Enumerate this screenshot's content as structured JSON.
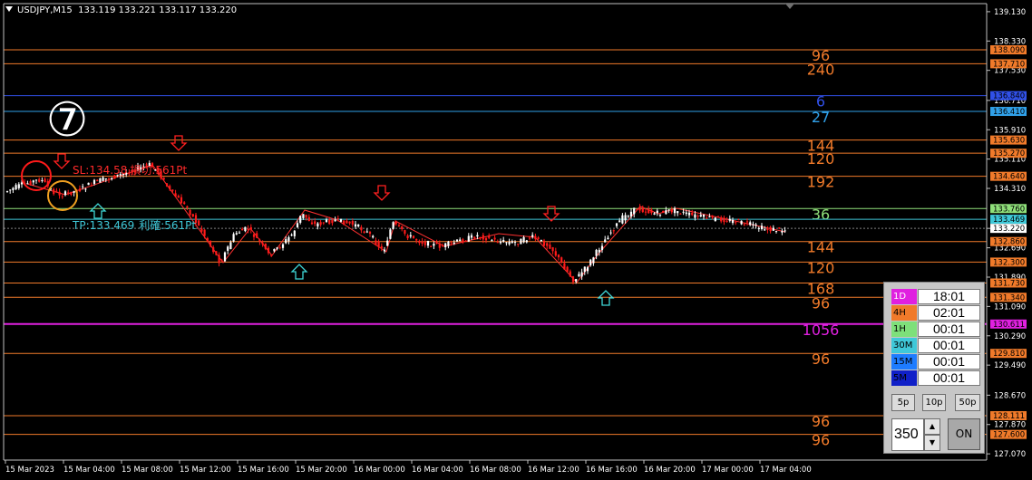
{
  "header": {
    "symbol": "USDJPY,M15",
    "ohlc": "133.119 133.221 133.117 133.220"
  },
  "price_axis": {
    "range": [
      126.9,
      139.35
    ],
    "ticks": [
      "139.130",
      "138.330",
      "137.530",
      "136.710",
      "135.910",
      "135.110",
      "134.310",
      "133.220",
      "132.690",
      "131.890",
      "131.090",
      "130.290",
      "129.490",
      "128.670",
      "127.870",
      "127.070"
    ]
  },
  "time_axis": {
    "labels": [
      "15 Mar 2023",
      "15 Mar 04:00",
      "15 Mar 08:00",
      "15 Mar 12:00",
      "15 Mar 16:00",
      "15 Mar 20:00",
      "16 Mar 00:00",
      "16 Mar 04:00",
      "16 Mar 08:00",
      "16 Mar 12:00",
      "16 Mar 16:00",
      "16 Mar 20:00",
      "17 Mar 00:00",
      "17 Mar 04:00"
    ]
  },
  "levels": [
    {
      "price": "138.090",
      "label": "96",
      "color": "#f07a2a",
      "tag_bg": "#f07a2a"
    },
    {
      "price": "137.710",
      "label": "240",
      "color": "#f07a2a",
      "tag_bg": "#f07a2a"
    },
    {
      "price": "136.840",
      "label": "6",
      "color": "#3050e8",
      "tag_bg": "#3050e8"
    },
    {
      "price": "136.410",
      "label": "27",
      "color": "#30a0e8",
      "tag_bg": "#30a0e8"
    },
    {
      "price": "135.630",
      "label": "144",
      "color": "#f07a2a",
      "tag_bg": "#f07a2a"
    },
    {
      "price": "135.270",
      "label": "120",
      "color": "#f07a2a",
      "tag_bg": "#f07a2a"
    },
    {
      "price": "134.640",
      "label": "192",
      "color": "#f07a2a",
      "tag_bg": "#f07a2a"
    },
    {
      "price": "133.760",
      "label": "36",
      "color": "#8fe07a",
      "tag_bg": "#8fe07a"
    },
    {
      "price": "133.469",
      "label": "",
      "color": "#3fc8d8",
      "tag_bg": "#3fc8d8"
    },
    {
      "price": "132.860",
      "label": "144",
      "color": "#f07a2a",
      "tag_bg": "#f07a2a"
    },
    {
      "price": "132.300",
      "label": "120",
      "color": "#f07a2a",
      "tag_bg": "#f07a2a"
    },
    {
      "price": "131.730",
      "label": "168",
      "color": "#f07a2a",
      "tag_bg": "#f07a2a"
    },
    {
      "price": "131.340",
      "label": "96",
      "color": "#f07a2a",
      "tag_bg": "#f07a2a"
    },
    {
      "price": "130.611",
      "label": "1056",
      "color": "#e020e0",
      "tag_bg": "#e020e0"
    },
    {
      "price": "129.810",
      "label": "96",
      "color": "#f07a2a",
      "tag_bg": "#f07a2a"
    },
    {
      "price": "128.111",
      "label": "96",
      "color": "#f07a2a",
      "tag_bg": "#f07a2a"
    },
    {
      "price": "127.600",
      "label": "96",
      "color": "#f07a2a",
      "tag_bg": "#f07a2a"
    }
  ],
  "current_price": {
    "price": "133.220",
    "tag_bg": "#ffffff"
  },
  "annotations": {
    "circle_number": "⑦",
    "sl_text": "SL:134.58",
    "sl_suffix": "損切:561Pt",
    "tp_text": "TP:133.469",
    "tp_suffix": "利確:561Pt"
  },
  "countdown_panel": {
    "rows": [
      {
        "tf": "1D",
        "time": "18:01",
        "bg": "#e020e0",
        "fg": "#ffffff"
      },
      {
        "tf": "4H",
        "time": "02:01",
        "bg": "#f07a2a",
        "fg": "#000000"
      },
      {
        "tf": "1H",
        "time": "00:01",
        "bg": "#7ee07a",
        "fg": "#000000"
      },
      {
        "tf": "30M",
        "time": "00:01",
        "bg": "#3fc8d8",
        "fg": "#000000"
      },
      {
        "tf": "15M",
        "time": "00:01",
        "bg": "#1e7cff",
        "fg": "#000000"
      },
      {
        "tf": "5M",
        "time": "00:01",
        "bg": "#1020c8",
        "fg": "#000000"
      }
    ],
    "buttons": [
      "5p",
      "10p",
      "50p"
    ],
    "spinner_value": "350",
    "on_label": "ON"
  },
  "colors": {
    "bull": "#ffffff",
    "bear": "#ff1a1a",
    "grid_frame": "#c0c0c0",
    "zigzag": "#ff3030"
  }
}
